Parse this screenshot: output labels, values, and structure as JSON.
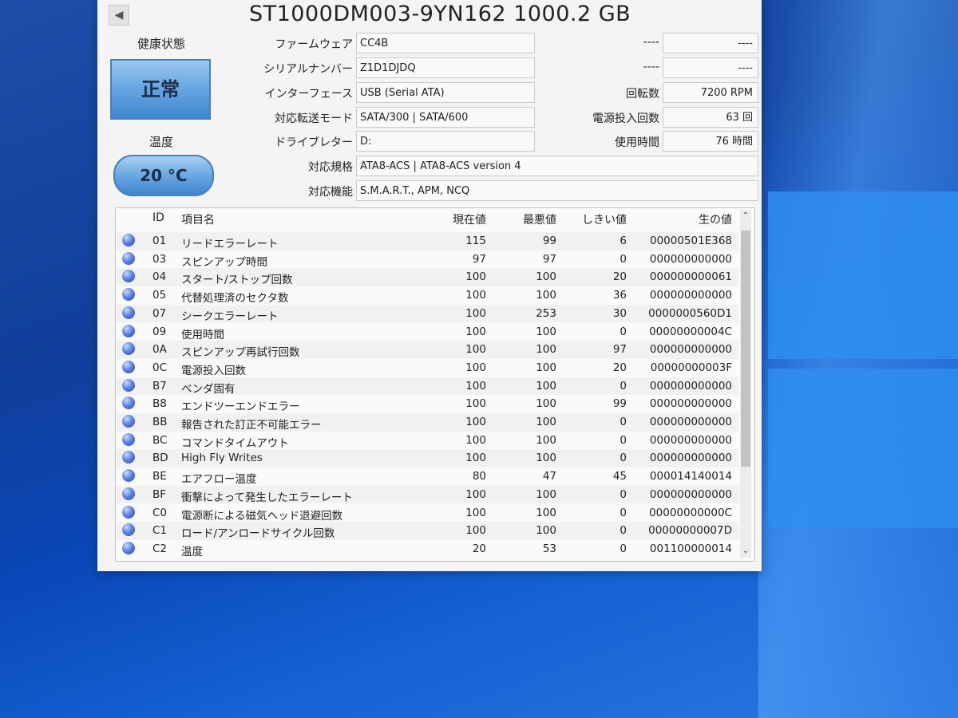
{
  "window": {
    "title": "ST1000DM003-9YN162 1000.2 GB",
    "back_glyph": "◀"
  },
  "status": {
    "health_label": "健康状態",
    "health_value": "正常",
    "temp_label": "温度",
    "temp_value": "20 °C"
  },
  "info": {
    "firmware_label": "ファームウェア",
    "firmware": "CC4B",
    "serial_label": "シリアルナンバー",
    "serial": "Z1D1DJDQ",
    "interface_label": "インターフェース",
    "interface": "USB (Serial ATA)",
    "transfer_label": "対応転送モード",
    "transfer": "SATA/300 | SATA/600",
    "drive_letter_label": "ドライブレター",
    "drive_letter": "D:",
    "standard_label": "対応規格",
    "standard": "ATA8-ACS | ATA8-ACS version 4",
    "features_label": "対応機能",
    "features": "S.M.A.R.T., APM, NCQ",
    "top1_label": "----",
    "top1_value": "----",
    "top2_label": "----",
    "top2_value": "----",
    "rpm_label": "回転数",
    "rpm": "7200 RPM",
    "power_count_label": "電源投入回数",
    "power_count": "63 回",
    "hours_label": "使用時間",
    "hours": "76 時間"
  },
  "table": {
    "headers": {
      "id": "ID",
      "name": "項目名",
      "current": "現在値",
      "worst": "最悪値",
      "threshold": "しきい値",
      "raw": "生の値"
    },
    "rows": [
      {
        "id": "01",
        "name": "リードエラーレート",
        "current": "115",
        "worst": "99",
        "threshold": "6",
        "raw": "00000501E368"
      },
      {
        "id": "03",
        "name": "スピンアップ時間",
        "current": "97",
        "worst": "97",
        "threshold": "0",
        "raw": "000000000000"
      },
      {
        "id": "04",
        "name": "スタート/ストップ回数",
        "current": "100",
        "worst": "100",
        "threshold": "20",
        "raw": "000000000061"
      },
      {
        "id": "05",
        "name": "代替処理済のセクタ数",
        "current": "100",
        "worst": "100",
        "threshold": "36",
        "raw": "000000000000"
      },
      {
        "id": "07",
        "name": "シークエラーレート",
        "current": "100",
        "worst": "253",
        "threshold": "30",
        "raw": "0000000560D1"
      },
      {
        "id": "09",
        "name": "使用時間",
        "current": "100",
        "worst": "100",
        "threshold": "0",
        "raw": "00000000004C"
      },
      {
        "id": "0A",
        "name": "スピンアップ再試行回数",
        "current": "100",
        "worst": "100",
        "threshold": "97",
        "raw": "000000000000"
      },
      {
        "id": "0C",
        "name": "電源投入回数",
        "current": "100",
        "worst": "100",
        "threshold": "20",
        "raw": "00000000003F"
      },
      {
        "id": "B7",
        "name": "ベンダ固有",
        "current": "100",
        "worst": "100",
        "threshold": "0",
        "raw": "000000000000"
      },
      {
        "id": "B8",
        "name": "エンドツーエンドエラー",
        "current": "100",
        "worst": "100",
        "threshold": "99",
        "raw": "000000000000"
      },
      {
        "id": "BB",
        "name": "報告された訂正不可能エラー",
        "current": "100",
        "worst": "100",
        "threshold": "0",
        "raw": "000000000000"
      },
      {
        "id": "BC",
        "name": "コマンドタイムアウト",
        "current": "100",
        "worst": "100",
        "threshold": "0",
        "raw": "000000000000"
      },
      {
        "id": "BD",
        "name": "High Fly Writes",
        "current": "100",
        "worst": "100",
        "threshold": "0",
        "raw": "000000000000"
      },
      {
        "id": "BE",
        "name": "エアフロー温度",
        "current": "80",
        "worst": "47",
        "threshold": "45",
        "raw": "000014140014"
      },
      {
        "id": "BF",
        "name": "衝撃によって発生したエラーレート",
        "current": "100",
        "worst": "100",
        "threshold": "0",
        "raw": "000000000000"
      },
      {
        "id": "C0",
        "name": "電源断による磁気ヘッド退避回数",
        "current": "100",
        "worst": "100",
        "threshold": "0",
        "raw": "00000000000C"
      },
      {
        "id": "C1",
        "name": "ロード/アンロードサイクル回数",
        "current": "100",
        "worst": "100",
        "threshold": "0",
        "raw": "00000000007D"
      },
      {
        "id": "C2",
        "name": "温度",
        "current": "20",
        "worst": "53",
        "threshold": "0",
        "raw": "001100000014"
      }
    ],
    "scroll_up_glyph": "⌃",
    "scroll_down_glyph": "⌄"
  }
}
